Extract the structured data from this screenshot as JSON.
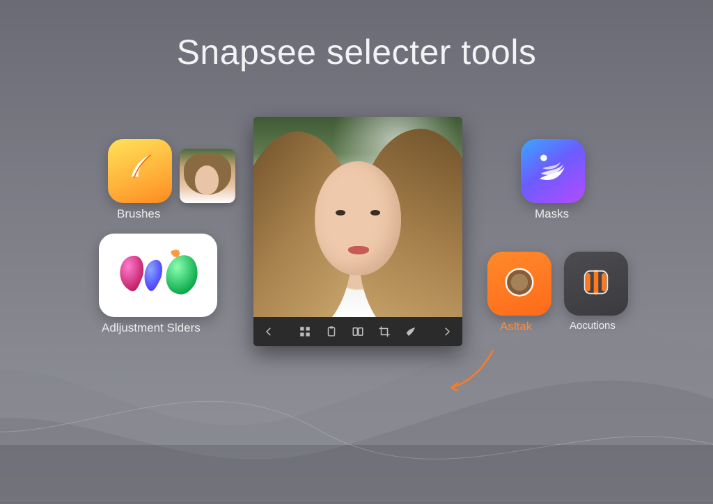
{
  "title": "Snapsee selecter tools",
  "tiles": {
    "brushes": {
      "label": "Brushes",
      "icon": "feather-icon"
    },
    "adjust": {
      "label": "Adljustment Slders",
      "icon": "blobs-icon"
    },
    "masks": {
      "label": "Masks",
      "icon": "swoosh-icon"
    },
    "asitak": {
      "label": "Asltak",
      "icon": "ring-icon"
    },
    "aocutions": {
      "label": "Aocutions",
      "icon": "bars-icon"
    }
  },
  "editor": {
    "toolbar": {
      "prev": "prev-icon",
      "grid": "grid-icon",
      "clipboard": "clipboard-icon",
      "compare": "compare-icon",
      "crop": "crop-icon",
      "paint": "paint-icon",
      "next": "next-icon"
    }
  },
  "colors": {
    "accent_orange": "#ff7a1f",
    "accent_purple": "#8a4bff",
    "accent_blue": "#3aa7ff",
    "text_light": "#ececee"
  }
}
